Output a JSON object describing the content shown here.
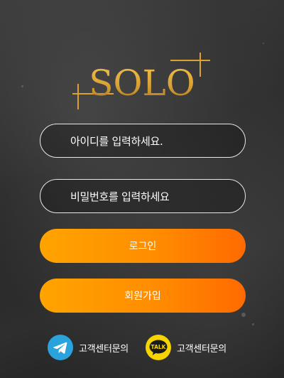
{
  "logo": {
    "text": "SOLO",
    "color": "#d9a233"
  },
  "login_form": {
    "id_placeholder": "아이디를 입력하세요.",
    "password_placeholder": "비밀번호를 입력하세요",
    "login_button": "로그인",
    "signup_button": "회원가입"
  },
  "contacts": [
    {
      "icon": "telegram-icon",
      "label": "고객센터문의"
    },
    {
      "icon": "kakaotalk-icon",
      "icon_text": "TALK",
      "label": "고객센터문의"
    }
  ],
  "colors": {
    "accent_start": "#ffa400",
    "accent_end": "#ff6a00",
    "telegram": "#2aa3dc",
    "kakao": "#f5d400"
  }
}
